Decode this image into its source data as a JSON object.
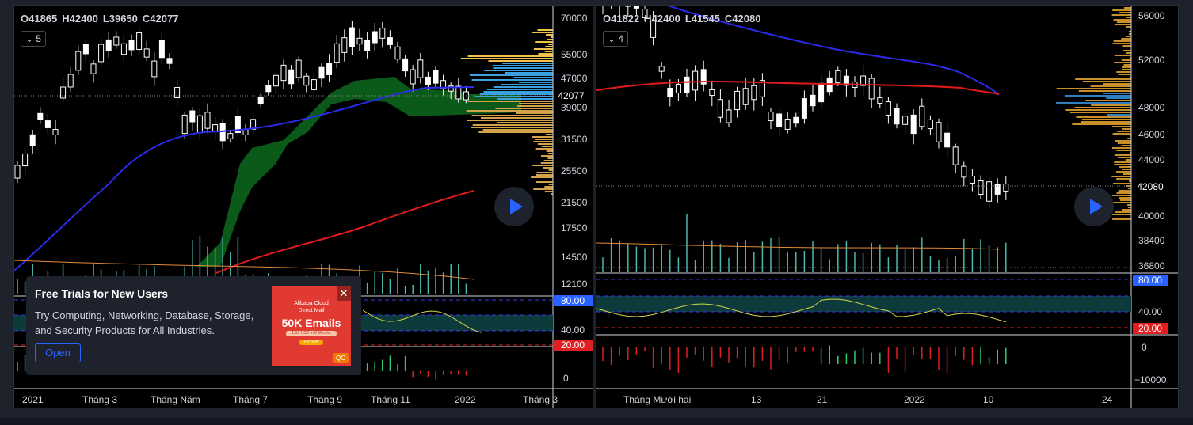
{
  "left_chart": {
    "ohlc": {
      "o": "O41865",
      "h": "H42400",
      "l": "L39650",
      "c": "C42077"
    },
    "indicator_count": "5",
    "price_axis": [
      "70000",
      "55000",
      "47000",
      "39000",
      "31500",
      "25500",
      "21500",
      "17500",
      "14500",
      "12100"
    ],
    "current_price": "42077",
    "osc_axis": {
      "upper": "80.00",
      "mid": "40.00",
      "lower": "20.00"
    },
    "macd_axis": "0",
    "time_axis": [
      "2021",
      "Tháng 3",
      "Tháng Năm",
      "Tháng 7",
      "Tháng 9",
      "Tháng 11",
      "2022",
      "Tháng 3"
    ]
  },
  "right_chart": {
    "ohlc": {
      "o": "O41822",
      "h": "H42400",
      "l": "L41545",
      "c": "C42080"
    },
    "indicator_count": "4",
    "price_axis": [
      "56000",
      "52000",
      "48000",
      "46000",
      "44000",
      "40000",
      "38400",
      "36800"
    ],
    "current_price": "42080",
    "osc_axis": {
      "upper": "80.00",
      "mid": "40.00",
      "lower": "20.00"
    },
    "macd_axis": [
      "0",
      "−10000"
    ],
    "time_axis": [
      "Tháng Mười hai",
      "13",
      "21",
      "2022",
      "10",
      "24"
    ]
  },
  "ad": {
    "title": "Free Trials for New Users",
    "text": "Try Computing, Networking, Database, Storage, and Security Products for All Industries.",
    "button": "Open",
    "image_brand": "Alibaba Cloud",
    "image_sub": "Direct Mail",
    "image_headline": "50K Emails",
    "image_pill": "1.5X USD in 6 Months",
    "image_button": "For Now",
    "badge": "QC"
  },
  "colors": {
    "bull": "#ffffff",
    "bear": "#ffffff",
    "ma_fast": "#2a2ae8",
    "ma_slow": "#e01b1b",
    "cloud": "#0b5a1a",
    "macd_up": "#2ecc71",
    "macd_down": "#e02020"
  }
}
